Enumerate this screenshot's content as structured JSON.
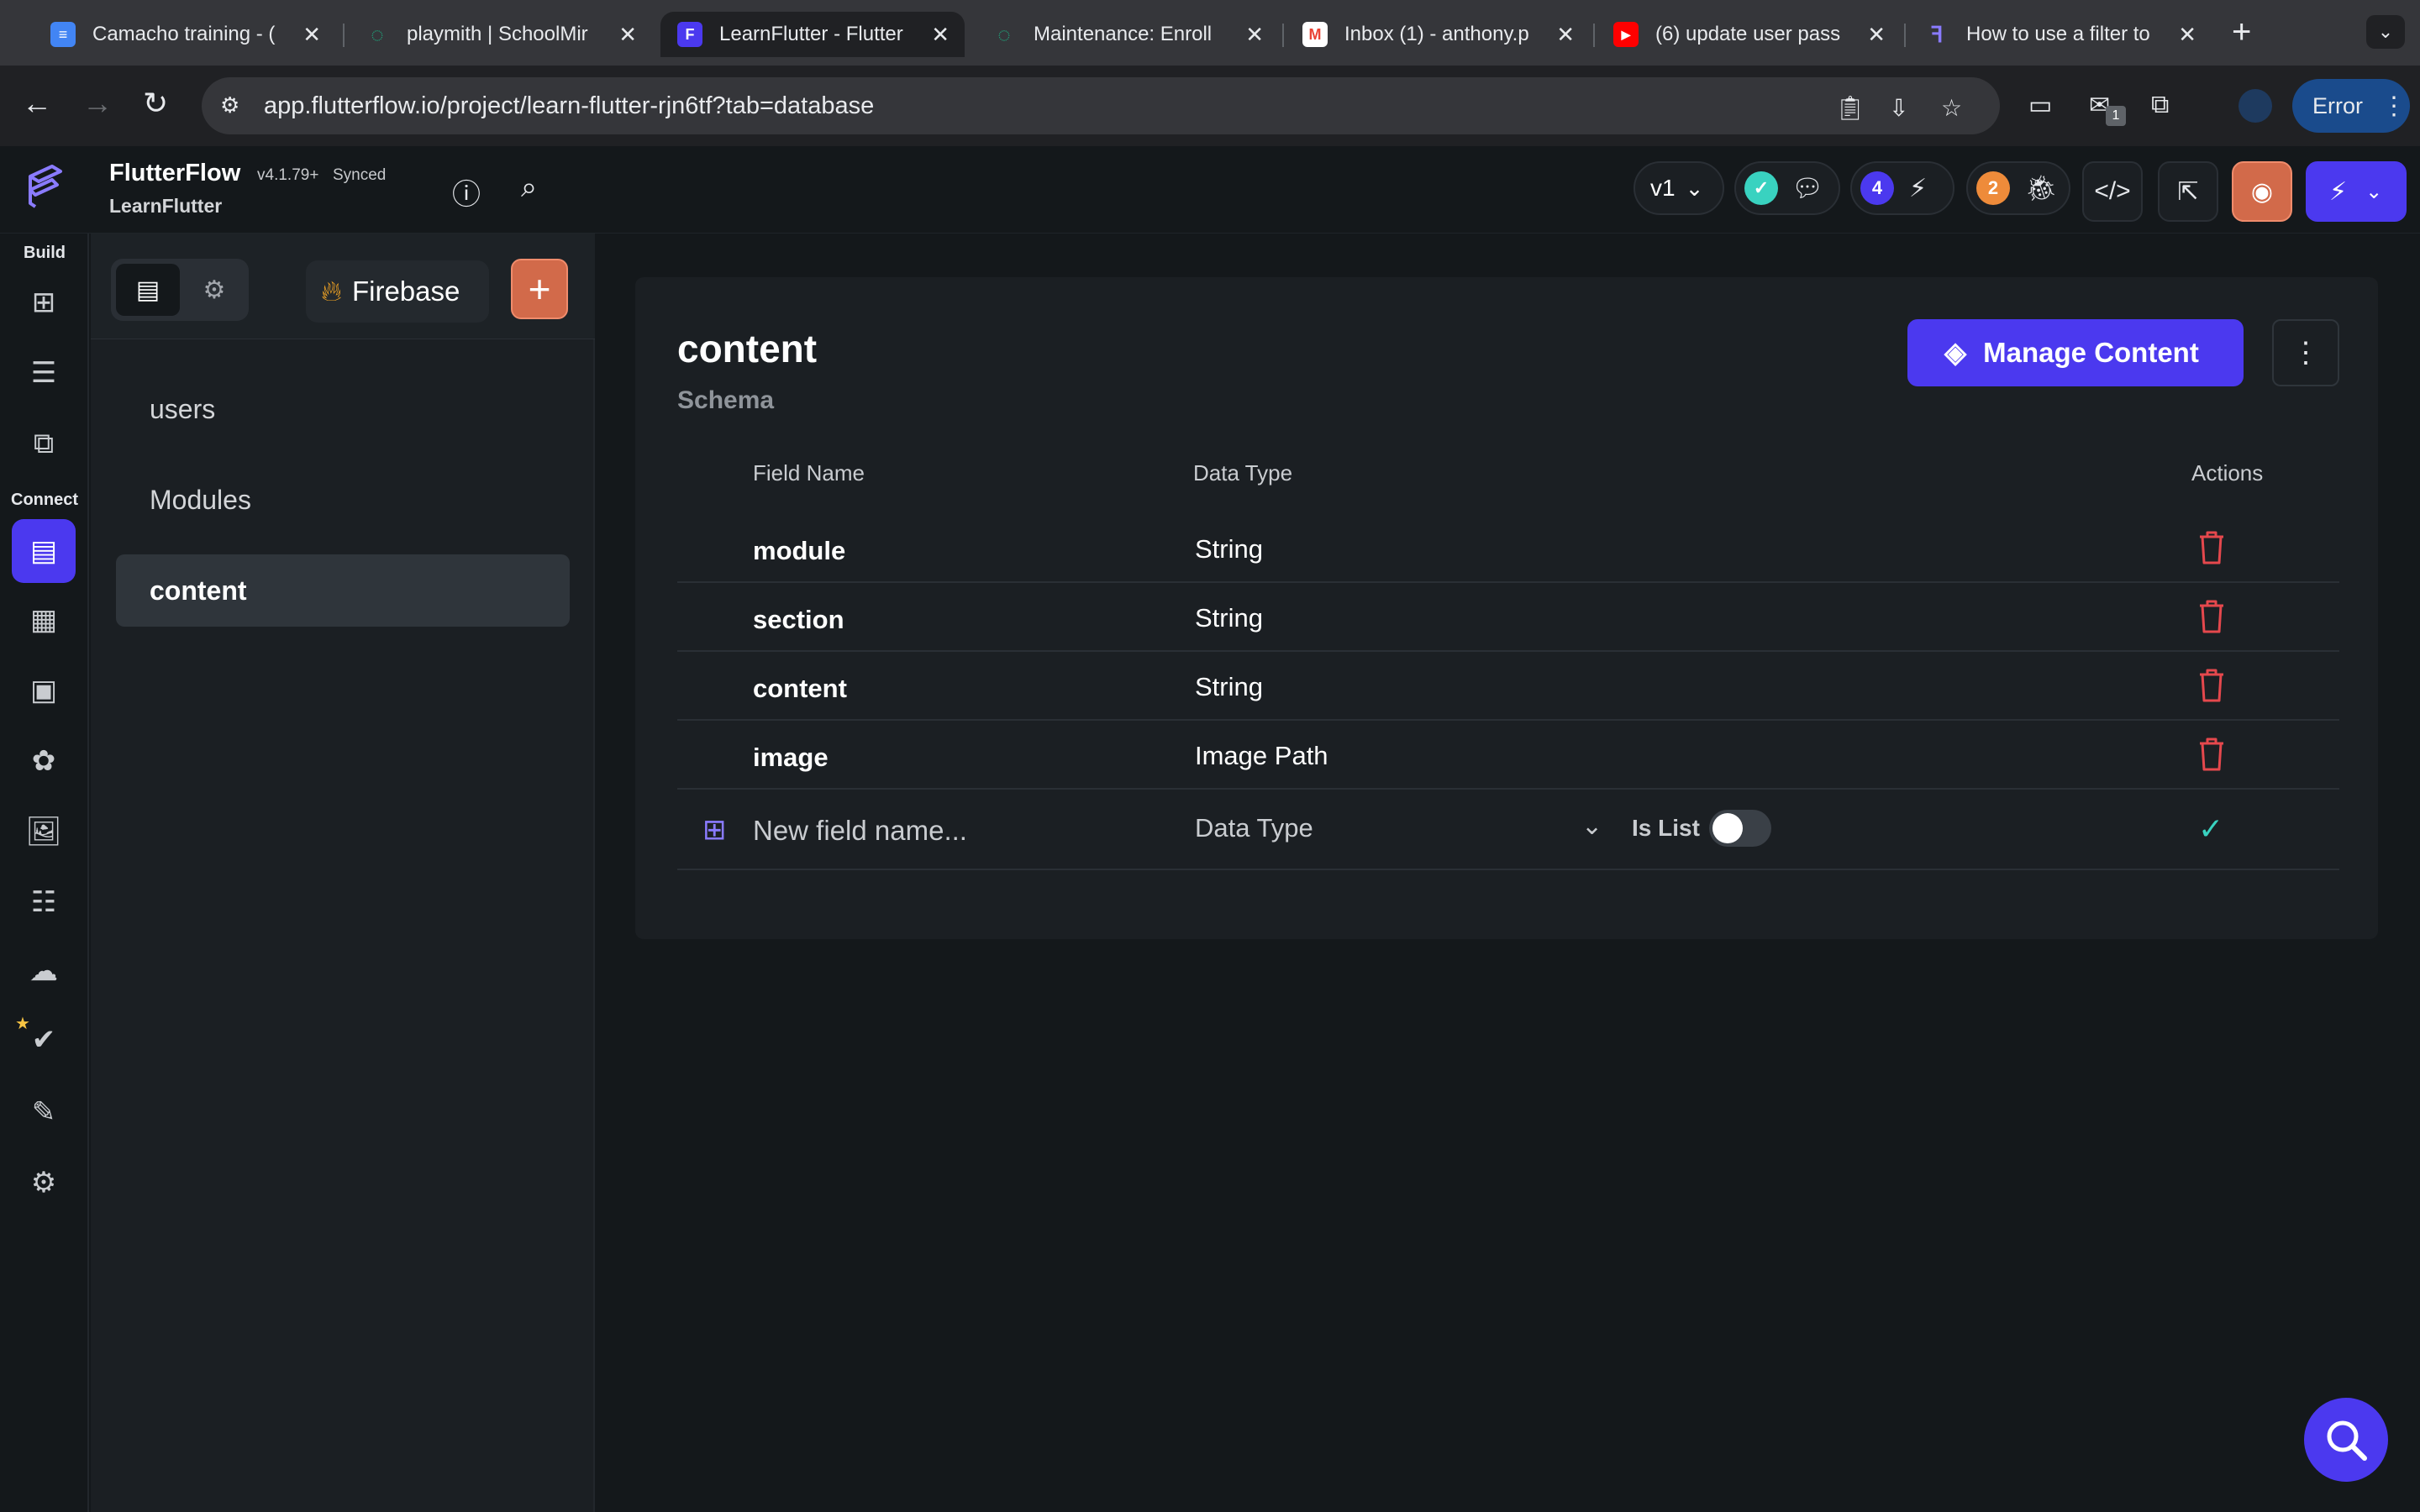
{
  "browser": {
    "tabs": [
      {
        "title": "Camacho training - (",
        "icon": "google-docs-icon",
        "color": "#4285f4"
      },
      {
        "title": "playmith | SchoolMir",
        "icon": "schoolmint-icon",
        "color": "#1fa37a"
      },
      {
        "title": "LearnFlutter - Flutter",
        "icon": "flutterflow-icon",
        "color": "#4b39ef"
      },
      {
        "title": "Maintenance: Enroll",
        "icon": "schoolmint-icon",
        "color": "#1fa37a"
      },
      {
        "title": "Inbox (1) - anthony.p",
        "icon": "gmail-icon",
        "color": "#ea4335"
      },
      {
        "title": "(6) update user pass",
        "icon": "youtube-icon",
        "color": "#ff0000"
      },
      {
        "title": "How to use a filter to",
        "icon": "flutterflow-icon",
        "color": "#4b39ef"
      }
    ],
    "url": "app.flutterflow.io/project/learn-flutter-rjn6tf?tab=database",
    "error_label": "Error",
    "extension_badge": "1"
  },
  "app": {
    "brand": "FlutterFlow",
    "version": "v4.1.79+",
    "sync_status": "Synced",
    "project": "LearnFlutter",
    "version_select": "v1",
    "comments_count": "4",
    "issues_count": "2",
    "accent": "#4b39ef"
  },
  "rail": {
    "build_label": "Build",
    "connect_label": "Connect"
  },
  "panel": {
    "provider": "Firebase",
    "collections": [
      "users",
      "Modules",
      "content"
    ]
  },
  "main": {
    "collection_title": "content",
    "schema_label": "Schema",
    "manage_label": "Manage Content",
    "headers": {
      "field": "Field Name",
      "type": "Data Type",
      "actions": "Actions"
    },
    "fields": [
      {
        "name": "module",
        "type": "String"
      },
      {
        "name": "section",
        "type": "String"
      },
      {
        "name": "content",
        "type": "String"
      },
      {
        "name": "image",
        "type": "Image Path"
      }
    ],
    "new_field": {
      "placeholder": "New field name...",
      "type_placeholder": "Data Type",
      "is_list_label": "Is List",
      "is_list": false
    }
  }
}
